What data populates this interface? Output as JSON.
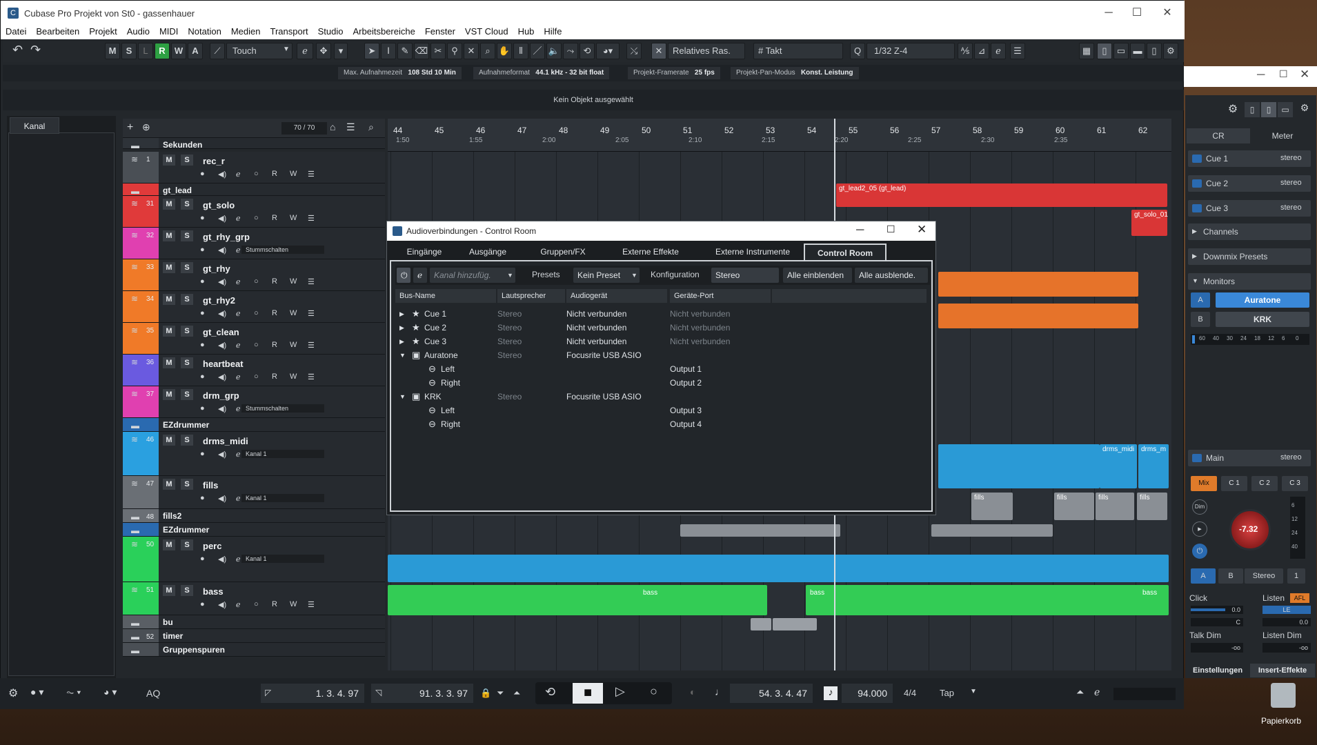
{
  "window": {
    "title": "Cubase Pro Projekt von St0 - gassenhauer"
  },
  "menu": [
    "Datei",
    "Bearbeiten",
    "Projekt",
    "Audio",
    "MIDI",
    "Notation",
    "Medien",
    "Transport",
    "Studio",
    "Arbeitsbereiche",
    "Fenster",
    "VST Cloud",
    "Hub",
    "Hilfe"
  ],
  "toolbar": {
    "msl": [
      "M",
      "S",
      "L",
      "R",
      "W",
      "A"
    ],
    "automation_mode": "Touch",
    "snap_mode": "Relatives Ras.",
    "grid": "Takt",
    "quantize": "1/32  Z-4"
  },
  "infoline": [
    {
      "label": "Max. Aufnahmezeit",
      "value": "108 Std 10 Min"
    },
    {
      "label": "Aufnahmeformat",
      "value": "44.1 kHz - 32 bit float"
    },
    {
      "label": "Projekt-Framerate",
      "value": "25 fps"
    },
    {
      "label": "Projekt-Pan-Modus",
      "value": "Konst. Leistung"
    }
  ],
  "objline": "Kein Objekt ausgewählt",
  "left": {
    "tab": "Kanal"
  },
  "tracklist": {
    "count": "70 / 70"
  },
  "ruler": {
    "bars": [
      "44",
      "45",
      "46",
      "47",
      "48",
      "49",
      "50",
      "51",
      "52",
      "53",
      "54",
      "55",
      "56",
      "57",
      "58",
      "59",
      "60",
      "61",
      "62"
    ],
    "seconds": [
      "1:50",
      "1:55",
      "2:00",
      "2:05",
      "2:10",
      "2:15",
      "2:20",
      "2:25",
      "2:30",
      "2:35"
    ]
  },
  "tracks": [
    {
      "num": "",
      "name": "Sekunden",
      "color": "#2e3339"
    },
    {
      "num": "1",
      "name": "rec_r",
      "color": "#4a4f55"
    },
    {
      "num": "",
      "name": "gt_lead",
      "color": "#e03a3a"
    },
    {
      "num": "31",
      "name": "gt_solo",
      "color": "#e03a3a"
    },
    {
      "num": "32",
      "name": "gt_rhy_grp",
      "color": "#e040b0",
      "sub": "Stummschalten"
    },
    {
      "num": "33",
      "name": "gt_rhy",
      "color": "#f07a28"
    },
    {
      "num": "34",
      "name": "gt_rhy2",
      "color": "#f07a28"
    },
    {
      "num": "35",
      "name": "gt_clean",
      "color": "#f07a28"
    },
    {
      "num": "36",
      "name": "heartbeat",
      "color": "#6a5ae0"
    },
    {
      "num": "37",
      "name": "drm_grp",
      "color": "#e040b0",
      "sub": "Stummschalten"
    },
    {
      "num": "",
      "name": "EZdrummer",
      "color": "#2a6ab0"
    },
    {
      "num": "46",
      "name": "drms_midi",
      "color": "#2aa0e0",
      "sub": "Kanal 1"
    },
    {
      "num": "47",
      "name": "fills",
      "color": "#6a6f75",
      "sub": "Kanal 1"
    },
    {
      "num": "48",
      "name": "fills2",
      "color": "#6a6f75"
    },
    {
      "num": "",
      "name": "EZdrummer",
      "color": "#2a6ab0"
    },
    {
      "num": "50",
      "name": "perc",
      "color": "#2ad05a",
      "sub": "Kanal 1"
    },
    {
      "num": "51",
      "name": "bass",
      "color": "#2ad05a"
    },
    {
      "num": "",
      "name": "bu",
      "color": "#5a5f65"
    },
    {
      "num": "52",
      "name": "timer",
      "color": "#4a4f55"
    },
    {
      "num": "",
      "name": "Gruppenspuren",
      "color": "#4a4f55"
    }
  ],
  "clips": {
    "gt_lead": "gt_lead2_05 (gt_lead)",
    "gt_solo": "gt_solo_01",
    "drms1": "drms_midi",
    "drms2": "drms_m",
    "fills": "fills",
    "bass": "bass"
  },
  "dialog": {
    "title": "Audioverbindungen - Control Room",
    "tabs": [
      "Eingänge",
      "Ausgänge",
      "Gruppen/FX",
      "Externe Effekte",
      "Externe Instrumente",
      "Control Room"
    ],
    "add_channel_placeholder": "Kanal hinzufüg.",
    "presets_label": "Presets",
    "preset_value": "Kein Preset",
    "config_label": "Konfiguration",
    "config_value": "Stereo",
    "show_all": "Alle einblenden",
    "hide_all": "Alle ausblende.",
    "columns": [
      "Bus-Name",
      "Lautsprecher",
      "Audiogerät",
      "Geräte-Port"
    ],
    "rows": [
      {
        "name": "Cue 1",
        "speaker": "Stereo",
        "device": "Nicht verbunden",
        "port": "Nicht verbunden",
        "level": 0,
        "type": "cue"
      },
      {
        "name": "Cue 2",
        "speaker": "Stereo",
        "device": "Nicht verbunden",
        "port": "Nicht verbunden",
        "level": 0,
        "type": "cue"
      },
      {
        "name": "Cue 3",
        "speaker": "Stereo",
        "device": "Nicht verbunden",
        "port": "Nicht verbunden",
        "level": 0,
        "type": "cue"
      },
      {
        "name": "Auratone",
        "speaker": "Stereo",
        "device": "Focusrite USB ASIO",
        "port": "",
        "level": 0,
        "type": "mon"
      },
      {
        "name": "Left",
        "speaker": "",
        "device": "",
        "port": "Output 1",
        "level": 1,
        "type": "ch"
      },
      {
        "name": "Right",
        "speaker": "",
        "device": "",
        "port": "Output 2",
        "level": 1,
        "type": "ch"
      },
      {
        "name": "KRK",
        "speaker": "Stereo",
        "device": "Focusrite USB ASIO",
        "port": "",
        "level": 0,
        "type": "mon"
      },
      {
        "name": "Left",
        "speaker": "",
        "device": "",
        "port": "Output 3",
        "level": 1,
        "type": "ch"
      },
      {
        "name": "Right",
        "speaker": "",
        "device": "",
        "port": "Output 4",
        "level": 1,
        "type": "ch"
      }
    ]
  },
  "rightpanel": {
    "tabs": [
      "CR",
      "Meter"
    ],
    "cues": [
      {
        "name": "Cue 1",
        "fmt": "stereo"
      },
      {
        "name": "Cue 2",
        "fmt": "stereo"
      },
      {
        "name": "Cue 3",
        "fmt": "stereo"
      }
    ],
    "sections": [
      "Channels",
      "Downmix Presets",
      "Monitors"
    ],
    "monitors": [
      {
        "key": "A",
        "name": "Auratone"
      },
      {
        "key": "B",
        "name": "KRK"
      }
    ],
    "meter_scale": [
      "60",
      "40",
      "30",
      "24",
      "18",
      "12",
      "6",
      "0"
    ],
    "main": {
      "name": "Main",
      "fmt": "stereo"
    },
    "mix_buttons": [
      "Mix",
      "C 1",
      "C 2",
      "C 3"
    ],
    "knob_value": "-7.32",
    "knob_scale": [
      "6",
      "12",
      "24",
      "40"
    ],
    "ab": [
      "A",
      "B",
      "Stereo",
      "1"
    ],
    "click_label": "Click",
    "listen_label": "Listen",
    "afl": "AFL",
    "le": "LE",
    "click_vals": [
      "0.0",
      "C"
    ],
    "listen_val": "0.0",
    "talkdim_label": "Talk Dim",
    "talkdim_val": "-oo",
    "listendim_label": "Listen Dim",
    "listendim_val": "-oo",
    "bottom_tabs": [
      "Einstellungen",
      "Insert-Effekte"
    ]
  },
  "transport": {
    "left_locator": "1. 3. 4. 97",
    "right_locator": "91. 3. 3. 97",
    "position": "54. 3. 4. 47",
    "tempo": "94.000",
    "signature": "4/4",
    "tap": "Tap",
    "aq": "AQ"
  },
  "desktop": {
    "recycle": "Papierkorb"
  }
}
